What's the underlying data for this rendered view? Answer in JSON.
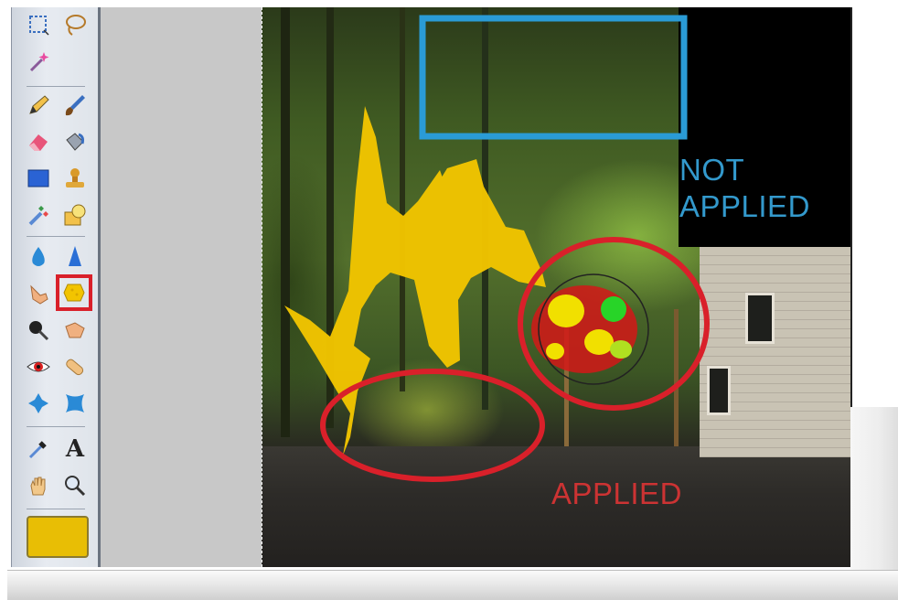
{
  "toolbar": {
    "tools": [
      {
        "name": "rect-select-tool",
        "icon": "marquee-icon"
      },
      {
        "name": "lasso-tool",
        "icon": "lasso-icon"
      },
      {
        "name": "magic-wand-tool",
        "icon": "magic-wand-icon"
      },
      {
        "name": "pencil-tool",
        "icon": "pencil-icon"
      },
      {
        "name": "brush-tool",
        "icon": "brush-icon"
      },
      {
        "name": "eraser-tool",
        "icon": "eraser-icon"
      },
      {
        "name": "fill-tool",
        "icon": "paint-bucket-icon"
      },
      {
        "name": "shape-tool",
        "icon": "rectangle-icon"
      },
      {
        "name": "clone-stamp-tool",
        "icon": "stamp-icon"
      },
      {
        "name": "color-replace-tool",
        "icon": "color-replace-icon"
      },
      {
        "name": "draw-shape-tool",
        "icon": "shape-icon"
      },
      {
        "name": "blur-tool",
        "icon": "drop-icon"
      },
      {
        "name": "sharpen-tool",
        "icon": "sharpen-icon"
      },
      {
        "name": "smudge-tool",
        "icon": "finger-icon"
      },
      {
        "name": "sponge-tool",
        "icon": "sponge-icon",
        "selected": true
      },
      {
        "name": "burn-tool",
        "icon": "burn-icon"
      },
      {
        "name": "dodge-tool",
        "icon": "dodge-icon"
      },
      {
        "name": "red-eye-tool",
        "icon": "red-eye-icon"
      },
      {
        "name": "spot-heal-tool",
        "icon": "bandage-icon"
      },
      {
        "name": "pinch-tool",
        "icon": "pinch-icon"
      },
      {
        "name": "bloat-tool",
        "icon": "bloat-icon"
      },
      {
        "name": "color-picker-tool",
        "icon": "eyedropper-icon"
      },
      {
        "name": "text-tool",
        "icon": "text-icon",
        "glyph": "A"
      },
      {
        "name": "hand-tool",
        "icon": "hand-icon"
      },
      {
        "name": "zoom-tool",
        "icon": "zoom-icon"
      }
    ],
    "foreground_color": "#e8be05"
  },
  "canvas": {
    "labels": {
      "not_applied": "NOT APPLIED",
      "applied": "APPLIED"
    },
    "colors": {
      "yellow_stroke": "#f1c400",
      "blue_box": "#2a9bd6",
      "red_circle": "#d9202a",
      "label_blue": "#3399cc",
      "label_red": "#cc3333"
    }
  }
}
